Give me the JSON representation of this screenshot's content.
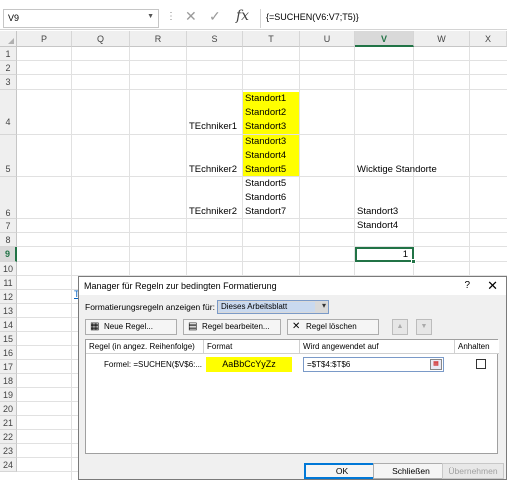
{
  "formula_bar": {
    "name_box": "V9",
    "formula": "{=SUCHEN(V6:V7;T5)}"
  },
  "columns": [
    "P",
    "Q",
    "R",
    "S",
    "T",
    "U",
    "V",
    "W",
    "X"
  ],
  "rows": [
    "1",
    "2",
    "3",
    "4",
    "5",
    "6",
    "7",
    "8",
    "9",
    "10",
    "11",
    "12",
    "13",
    "14",
    "15",
    "16",
    "17",
    "18",
    "19",
    "20",
    "21",
    "22",
    "23",
    "24"
  ],
  "cells": {
    "s4": "TEchniker1",
    "t4": [
      "Standort1",
      "Standort2",
      "Standort3"
    ],
    "s5": "TEchniker2",
    "t5": [
      "Standort3",
      "Standort4",
      "Standort5"
    ],
    "v5": "Wicktige Standorte",
    "s6": "TEchniker2",
    "t6": [
      "Standort5",
      "Standort6",
      "Standort7"
    ],
    "v6": "Standort3",
    "v7": "Standort4",
    "v9": "1",
    "p12_link": "T"
  },
  "dialog": {
    "title": "Manager für Regeln zur bedingten Formatierung",
    "help": "?",
    "close": "✕",
    "show_rules_label": "Formatierungsregeln anzeigen für:",
    "show_rules_value": "Dieses Arbeitsblatt",
    "new_rule": "Neue Regel...",
    "edit_rule": "Regel bearbeiten...",
    "delete_rule": "Regel löschen",
    "headers": {
      "rule": "Regel (in angez. Reihenfolge)",
      "format": "Format",
      "applies": "Wird angewendet auf",
      "stop": "Anhalten"
    },
    "rule_row": {
      "rule": "Formel: =SUCHEN($V$6:...",
      "format_preview": "AaBbCcYyZz",
      "applies_to": "=$T$4:$T$6"
    },
    "ok": "OK",
    "close_btn": "Schließen",
    "apply_btn": "Übernehmen"
  }
}
